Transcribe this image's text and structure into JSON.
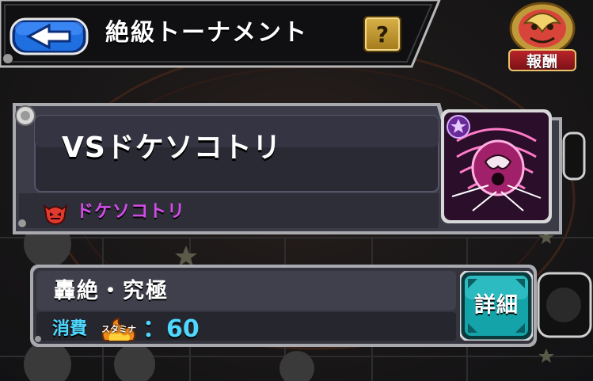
{
  "header": {
    "title": "絶級トーナメント",
    "help_label": "?"
  },
  "reward": {
    "label": "報酬"
  },
  "quest": {
    "name": "VSドケソコトリ",
    "boss_name": "ドケソコトリ"
  },
  "difficulty": {
    "label": "轟絶・究極",
    "cost_label": "消費",
    "stamina_icon_text": "スタミナ",
    "cost_value": "：60"
  },
  "detail_button": {
    "label": "詳細"
  },
  "colors": {
    "boss_name": "#d24de8",
    "cost": "#4fd8ff",
    "back_button": "#1f6fe0",
    "detail_button": "#14a3a8",
    "help_button": "#c69a2e",
    "reward_banner": "#a81d22"
  }
}
